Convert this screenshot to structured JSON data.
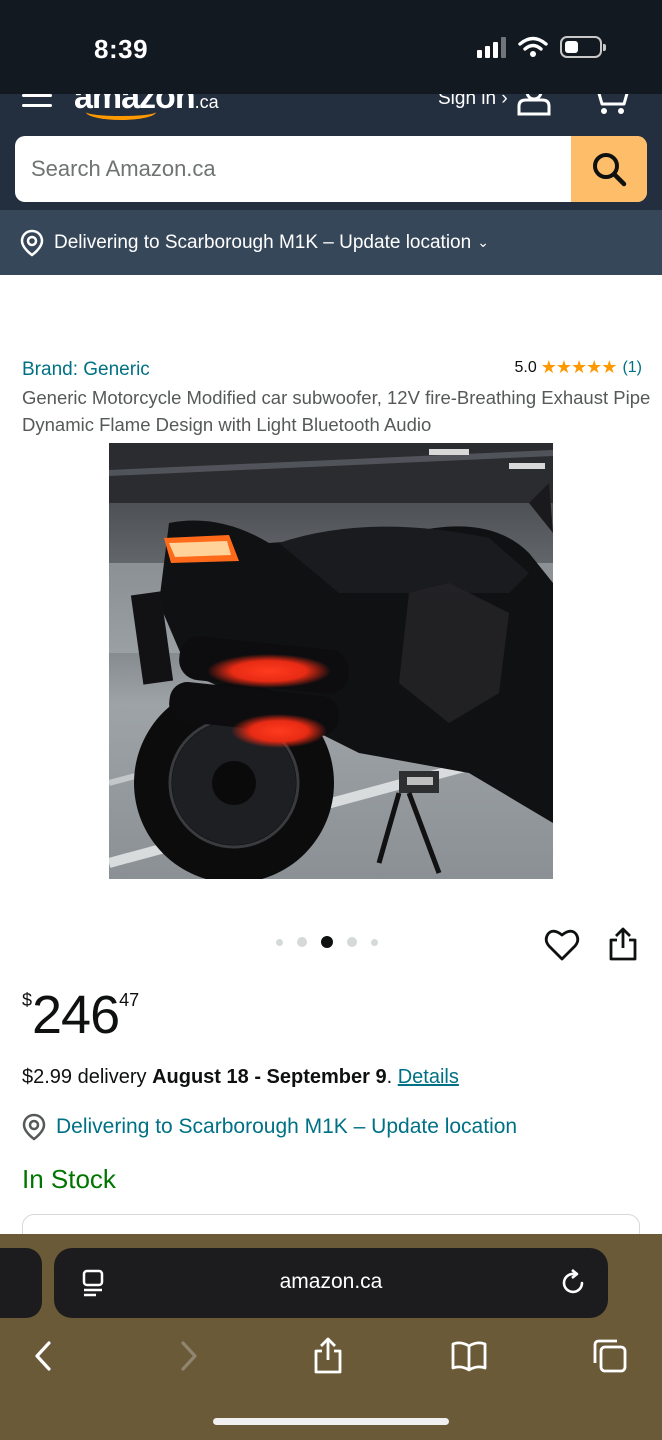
{
  "status_bar": {
    "time": "8:39"
  },
  "header": {
    "logo_text": "amazon",
    "logo_suffix": ".ca",
    "sign_in": "Sign in ›",
    "icons": [
      "menu-icon",
      "user-icon",
      "cart-icon",
      "search-icon"
    ],
    "search": {
      "placeholder": "Search Amazon.ca",
      "value": ""
    }
  },
  "location_bar": {
    "text": "Delivering to Scarborough M1K – Update location",
    "chevron": "⌄"
  },
  "product": {
    "brand": "Brand: Generic",
    "rating_value": "5.0",
    "rating_stars": "★★★★★",
    "rating_count": "(1)",
    "title": "Generic Motorcycle Modified car subwoofer, 12V fire-Breathing Exhaust Pipe Dynamic Flame Design with Light Bluetooth Audio",
    "image_carousel": {
      "total": 5,
      "active_index": 2
    },
    "price": {
      "symbol": "$",
      "whole": "246",
      "fraction": "47"
    },
    "delivery": {
      "prefix": "$2.99 delivery ",
      "dates": "August 18 - September 9",
      "separator": ". ",
      "details_link": "Details"
    },
    "deliver_location": "Delivering to Scarborough M1K – Update location",
    "stock": "In Stock"
  },
  "browser": {
    "url": "amazon.ca",
    "nav_icons": [
      "back-icon",
      "forward-icon",
      "share-icon",
      "bookmarks-icon",
      "tabs-icon"
    ]
  },
  "colors": {
    "header_dark": "#131921",
    "header": "#232f3e",
    "location_bar": "#37475a",
    "search_button": "#febd69",
    "link": "#007185",
    "in_stock": "#007600",
    "star": "#ff9900"
  }
}
